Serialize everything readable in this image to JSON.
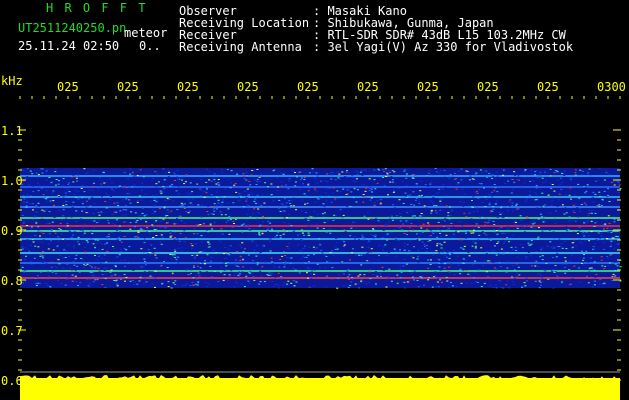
{
  "header": {
    "logo": "H R O F F T",
    "filename": "UT2511240250.pn",
    "meteor_label": "meteor",
    "datetime": "25.11.24 02:50",
    "count": "0..",
    "info": [
      {
        "label": "Observer",
        "value": ": Masaki Kano"
      },
      {
        "label": "Receiving Location",
        "value": ": Shibukawa, Gunma, Japan"
      },
      {
        "label": "Receiver",
        "value": ": RTL-SDR SDR# 43dB L15 103.2MHz CW"
      },
      {
        "label": "Receiving Antenna",
        "value": ": 3el Yagi(V) Az 330 for Vladivostok"
      }
    ]
  },
  "y_axis": {
    "unit": "kHz",
    "ticks": [
      "1.1",
      "1.0",
      "0.9",
      "0.8",
      "0.7",
      "0.6"
    ]
  },
  "time_axis": {
    "ticks": [
      "025",
      "025",
      "025",
      "025",
      "025",
      "025",
      "025",
      "025",
      "025",
      "0300"
    ]
  },
  "colors": {
    "header_green": "#22dd22",
    "axis_yellow": "#ffff00",
    "noise_base": "#0a1a9a",
    "signal_red": "#ff2020",
    "noise_bar": "#ffff00"
  }
}
